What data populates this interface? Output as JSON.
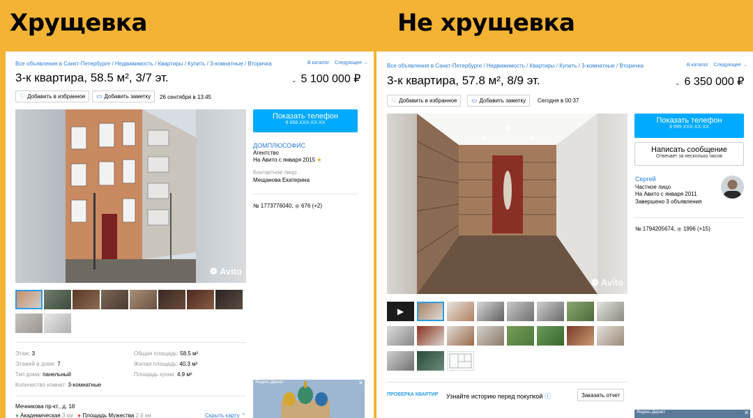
{
  "left": {
    "label": "Хрущевка",
    "breadcrumbs": "Все объявления в Санкт-Петербурге / Недвижимость / Квартиры / Купить / 3-комнатные / Вторичка",
    "nav_catalog": "В каталог",
    "nav_next": "Следующее →",
    "title": "3-к квартира, 58.5 м², 3/7 эт.",
    "price": "5 100 000 ₽",
    "fav_label": "Добавить в избранное",
    "note_label": "Добавить заметку",
    "date": "26 сентября в 13:45",
    "watermark": "Avito",
    "call_label": "Показать телефон",
    "call_number": "8 958 XXX-XX-XX",
    "seller_name": "ДОМПЛЮСОФИС",
    "seller_type": "Агентство",
    "seller_since": "На Авито с января 2015",
    "contact_label": "Контактное лицо",
    "contact_name": "Мещанова Екатерина",
    "ad_id": "№ 1773776040,",
    "views": "676 (+2)",
    "params_left": [
      {
        "k": "Этаж:",
        "v": "3"
      },
      {
        "k": "Этажей в доме:",
        "v": "7"
      },
      {
        "k": "Тип дома:",
        "v": "панельный"
      },
      {
        "k": "Количество комнат:",
        "v": "3-комнатные"
      }
    ],
    "params_right": [
      {
        "k": "Общая площадь:",
        "v": "58.5 м²"
      },
      {
        "k": "Жилая площадь:",
        "v": "40.3 м²"
      },
      {
        "k": "Площадь кухни:",
        "v": "4.9 м²"
      }
    ],
    "address": "Мечникова пр-кт., д. 18",
    "metro1": "Академическая",
    "metro1_dist": "3 км",
    "metro2": "Площадь Мужества",
    "metro2_dist": "2.6 км",
    "hide_map": "Скрыть карту",
    "ad_label": "Яндекс.Директ",
    "ad_close": "✕"
  },
  "right": {
    "label": "Не хрущевка",
    "breadcrumbs": "Все объявления в Санкт-Петербурге / Недвижимость / Квартиры / Купить / 3-комнатные / Вторичка",
    "nav_catalog": "В каталог",
    "nav_next": "Следующее →",
    "title": "3-к квартира, 57.8 м², 8/9 эт.",
    "price": "6 350 000 ₽",
    "fav_label": "Добавить в избранное",
    "note_label": "Добавить заметку",
    "date": "Сегодня в 00:37",
    "watermark": "Avito",
    "call_label": "Показать телефон",
    "call_number": "8 999 XXX-XX-XX",
    "msg_label": "Написать сообщение",
    "msg_sub": "Отвечает за несколько часов",
    "seller_name": "Сергей",
    "seller_type": "Частное лицо",
    "seller_since": "На Авито с января 2011",
    "seller_done": "Завершено 3 объявления",
    "ad_id": "№ 1794205674,",
    "views": "1996 (+15)",
    "check_label": "ПРОВЕРКА КВАРТИР",
    "check_text": "Узнайте историю перед покупкой",
    "check_button": "Заказать отчет",
    "ad_label": "Яндекс.Директ",
    "ad_close": "✕"
  }
}
